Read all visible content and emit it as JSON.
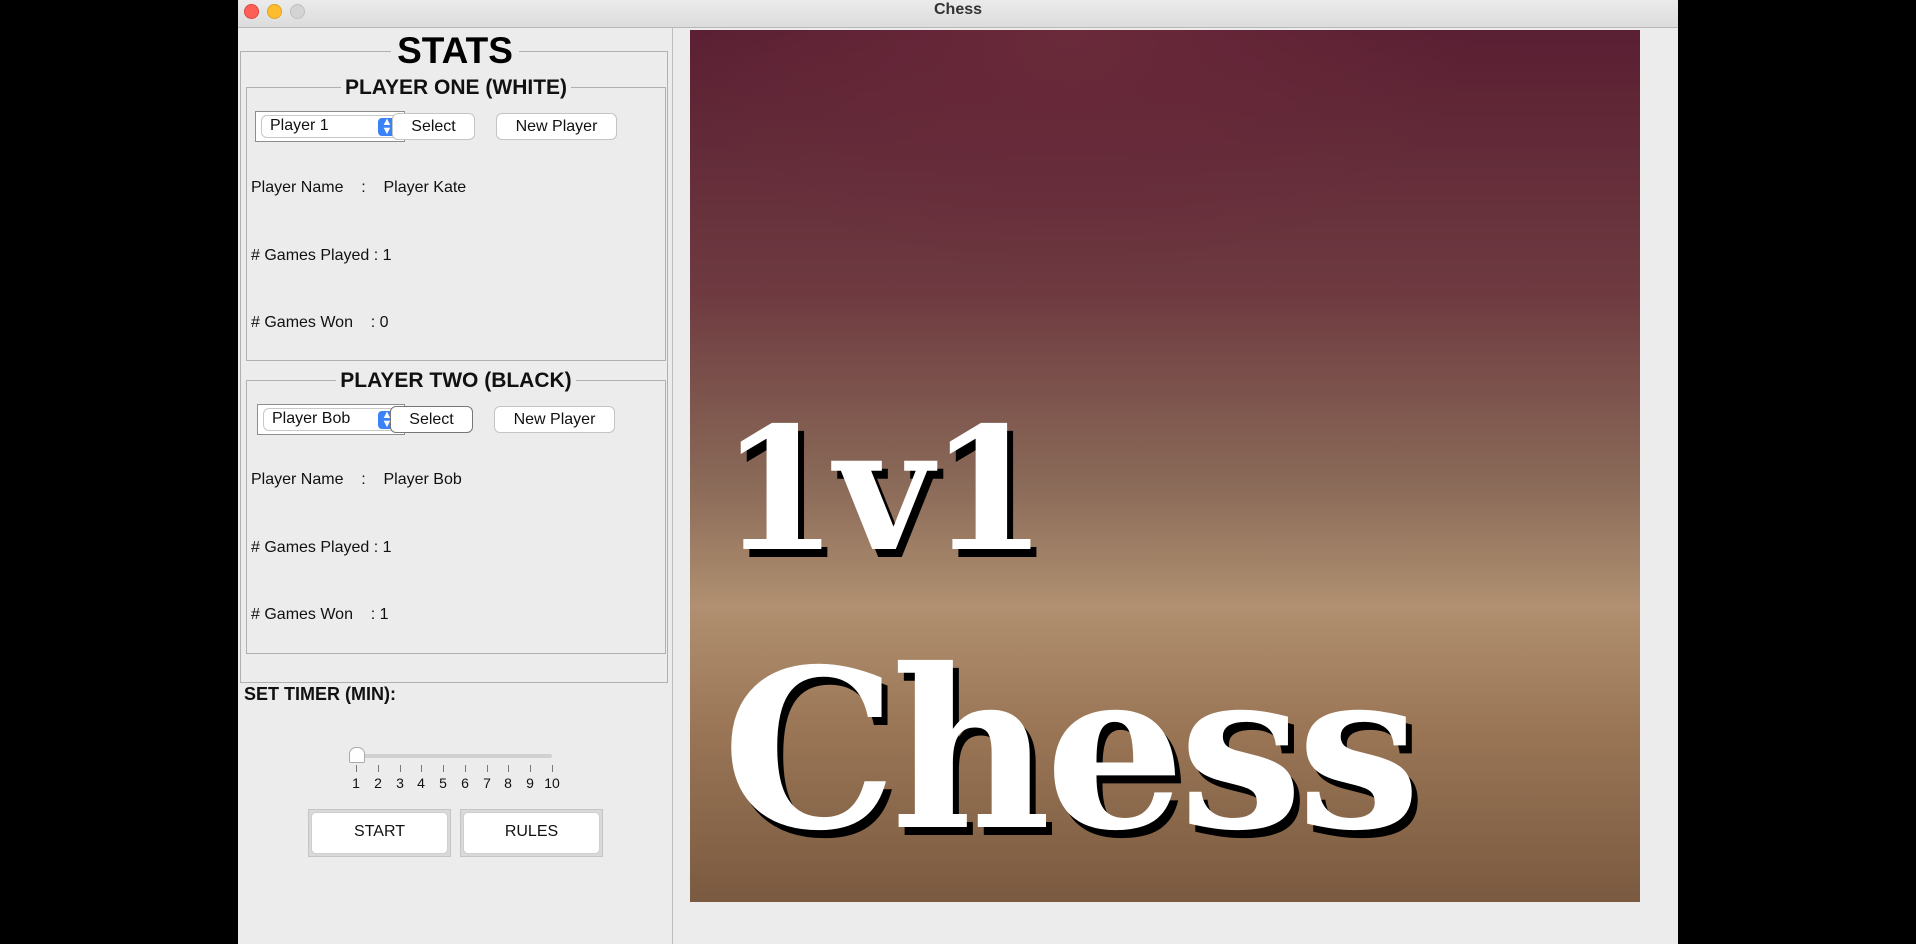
{
  "window": {
    "title": "Chess"
  },
  "stats": {
    "title": "STATS"
  },
  "player_one": {
    "title": "PLAYER ONE (WHITE)",
    "selected": "Player 1",
    "select_label": "Select",
    "new_player_label": "New Player",
    "name_row": "Player Name    :    Player Kate",
    "played_row": "# Games Played : 1",
    "won_row": "# Games Won    : 0"
  },
  "player_two": {
    "title": "PLAYER TWO (BLACK)",
    "selected": "Player Bob",
    "select_label": "Select",
    "new_player_label": "New Player",
    "name_row": "Player Name    :    Player Bob",
    "played_row": "# Games Played : 1",
    "won_row": "# Games Won    : 1"
  },
  "timer": {
    "label": "SET TIMER (MIN):",
    "value": 1,
    "min": 1,
    "max": 10,
    "ticks": [
      "1",
      "2",
      "3",
      "4",
      "5",
      "6",
      "7",
      "8",
      "9",
      "10"
    ]
  },
  "actions": {
    "start_label": "START",
    "rules_label": "RULES"
  },
  "image": {
    "text_line1": "1v1",
    "text_line2": "Chess"
  },
  "icons": {
    "combo_arrow": "chevron-updown-icon"
  }
}
